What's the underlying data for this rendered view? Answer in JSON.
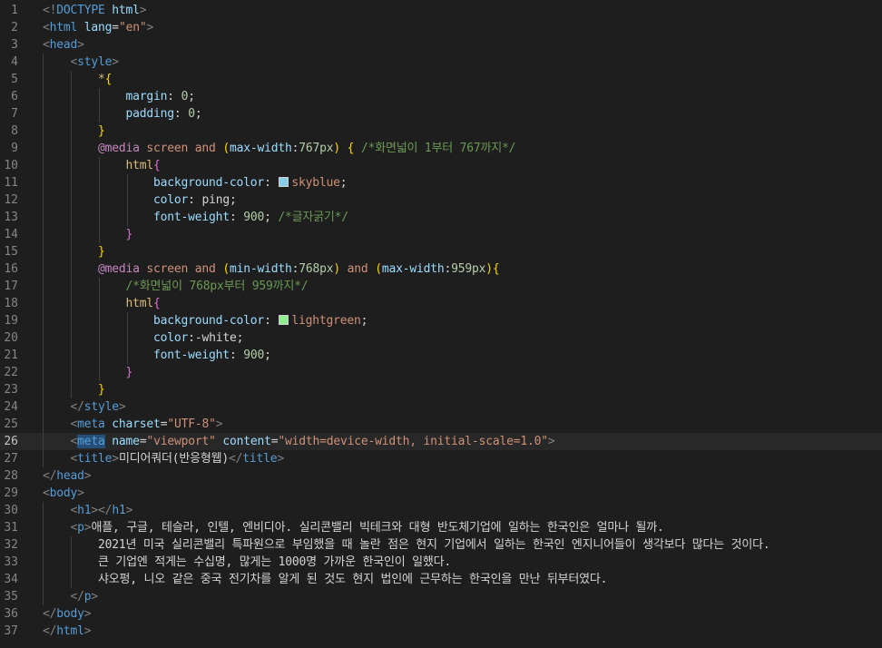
{
  "editor": {
    "active_line": 26,
    "lines": [
      {
        "n": "1",
        "tokens": [
          [
            "<!",
            "t-punc"
          ],
          [
            "DOCTYPE",
            "t-tag"
          ],
          [
            " html",
            "t-attr"
          ],
          [
            ">",
            "t-punc"
          ]
        ]
      },
      {
        "n": "2",
        "tokens": [
          [
            "<",
            "t-punc"
          ],
          [
            "html",
            "t-tag"
          ],
          [
            " lang",
            "t-attr"
          ],
          [
            "=",
            "t-txt"
          ],
          [
            "\"en\"",
            "t-str"
          ],
          [
            ">",
            "t-punc"
          ]
        ]
      },
      {
        "n": "3",
        "tokens": [
          [
            "<",
            "t-punc"
          ],
          [
            "head",
            "t-tag"
          ],
          [
            ">",
            "t-punc"
          ]
        ]
      },
      {
        "n": "4",
        "tokens": [
          [
            "    ",
            "t-txt"
          ],
          [
            "<",
            "t-punc"
          ],
          [
            "style",
            "t-tag"
          ],
          [
            ">",
            "t-punc"
          ]
        ]
      },
      {
        "n": "5",
        "tokens": [
          [
            "        ",
            "t-txt"
          ],
          [
            "*",
            "t-sel"
          ],
          [
            "{",
            "t-br"
          ]
        ]
      },
      {
        "n": "6",
        "tokens": [
          [
            "            ",
            "t-txt"
          ],
          [
            "margin",
            "t-prop"
          ],
          [
            ": ",
            "t-txt"
          ],
          [
            "0",
            "t-num"
          ],
          [
            ";",
            "t-txt"
          ]
        ]
      },
      {
        "n": "7",
        "tokens": [
          [
            "            ",
            "t-txt"
          ],
          [
            "padding",
            "t-prop"
          ],
          [
            ": ",
            "t-txt"
          ],
          [
            "0",
            "t-num"
          ],
          [
            ";",
            "t-txt"
          ]
        ]
      },
      {
        "n": "8",
        "tokens": [
          [
            "        ",
            "t-txt"
          ],
          [
            "}",
            "t-br"
          ]
        ]
      },
      {
        "n": "9",
        "tokens": [
          [
            "        ",
            "t-txt"
          ],
          [
            "@media",
            "t-at"
          ],
          [
            " screen ",
            "t-kw"
          ],
          [
            "and",
            "t-kw"
          ],
          [
            " ",
            "t-txt"
          ],
          [
            "(",
            "t-br"
          ],
          [
            "max-width",
            "t-prop"
          ],
          [
            ":",
            "t-txt"
          ],
          [
            "767px",
            "t-num"
          ],
          [
            ")",
            "t-br"
          ],
          [
            " ",
            "t-txt"
          ],
          [
            "{",
            "t-br"
          ],
          [
            " ",
            "t-txt"
          ],
          [
            "/*화면넓이 1부터 767까지*/",
            "t-com"
          ]
        ]
      },
      {
        "n": "10",
        "tokens": [
          [
            "            ",
            "t-txt"
          ],
          [
            "html",
            "t-sel"
          ],
          [
            "{",
            "t-br2"
          ]
        ]
      },
      {
        "n": "11",
        "tokens": [
          [
            "                ",
            "t-txt"
          ],
          [
            "background-color",
            "t-prop"
          ],
          [
            ": ",
            "t-txt"
          ],
          [
            "#skyblue",
            "swatch:#87ceeb"
          ],
          [
            "skyblue",
            "t-str"
          ],
          [
            ";",
            "t-txt"
          ]
        ]
      },
      {
        "n": "12",
        "tokens": [
          [
            "                ",
            "t-txt"
          ],
          [
            "color",
            "t-prop"
          ],
          [
            ": ",
            "t-txt"
          ],
          [
            "ping",
            "t-txt"
          ],
          [
            ";",
            "t-txt"
          ]
        ]
      },
      {
        "n": "13",
        "tokens": [
          [
            "                ",
            "t-txt"
          ],
          [
            "font-weight",
            "t-prop"
          ],
          [
            ": ",
            "t-txt"
          ],
          [
            "900",
            "t-num"
          ],
          [
            "; ",
            "t-txt"
          ],
          [
            "/*글자굵기*/",
            "t-com"
          ]
        ]
      },
      {
        "n": "14",
        "tokens": [
          [
            "            ",
            "t-txt"
          ],
          [
            "}",
            "t-br2"
          ]
        ]
      },
      {
        "n": "15",
        "tokens": [
          [
            "        ",
            "t-txt"
          ],
          [
            "}",
            "t-br"
          ]
        ]
      },
      {
        "n": "16",
        "tokens": [
          [
            "        ",
            "t-txt"
          ],
          [
            "@media",
            "t-at"
          ],
          [
            " screen ",
            "t-kw"
          ],
          [
            "and",
            "t-kw"
          ],
          [
            " ",
            "t-txt"
          ],
          [
            "(",
            "t-br"
          ],
          [
            "min-width",
            "t-prop"
          ],
          [
            ":",
            "t-txt"
          ],
          [
            "768px",
            "t-num"
          ],
          [
            ")",
            "t-br"
          ],
          [
            " ",
            "t-txt"
          ],
          [
            "and",
            "t-kw"
          ],
          [
            " ",
            "t-txt"
          ],
          [
            "(",
            "t-br"
          ],
          [
            "max-width",
            "t-prop"
          ],
          [
            ":",
            "t-txt"
          ],
          [
            "959px",
            "t-num"
          ],
          [
            ")",
            "t-br"
          ],
          [
            "{",
            "t-br"
          ]
        ]
      },
      {
        "n": "17",
        "tokens": [
          [
            "            ",
            "t-txt"
          ],
          [
            "/*화면넓이 768px부터 959까지*/",
            "t-com"
          ]
        ]
      },
      {
        "n": "18",
        "tokens": [
          [
            "            ",
            "t-txt"
          ],
          [
            "html",
            "t-sel"
          ],
          [
            "{",
            "t-br2"
          ]
        ]
      },
      {
        "n": "19",
        "tokens": [
          [
            "                ",
            "t-txt"
          ],
          [
            "background-color",
            "t-prop"
          ],
          [
            ": ",
            "t-txt"
          ],
          [
            "#lightgreen",
            "swatch:#90ee90"
          ],
          [
            "lightgreen",
            "t-str"
          ],
          [
            ";",
            "t-txt"
          ]
        ]
      },
      {
        "n": "20",
        "tokens": [
          [
            "                ",
            "t-txt"
          ],
          [
            "color",
            "t-prop"
          ],
          [
            ":",
            "t-txt"
          ],
          [
            "-white",
            "t-txt"
          ],
          [
            ";",
            "t-txt"
          ]
        ]
      },
      {
        "n": "21",
        "tokens": [
          [
            "                ",
            "t-txt"
          ],
          [
            "font-weight",
            "t-prop"
          ],
          [
            ": ",
            "t-txt"
          ],
          [
            "900",
            "t-num"
          ],
          [
            ";",
            "t-txt"
          ]
        ]
      },
      {
        "n": "22",
        "tokens": [
          [
            "            ",
            "t-txt"
          ],
          [
            "}",
            "t-br2"
          ]
        ]
      },
      {
        "n": "23",
        "tokens": [
          [
            "        ",
            "t-txt"
          ],
          [
            "}",
            "t-br"
          ]
        ]
      },
      {
        "n": "24",
        "tokens": [
          [
            "    ",
            "t-txt"
          ],
          [
            "</",
            "t-punc"
          ],
          [
            "style",
            "t-tag"
          ],
          [
            ">",
            "t-punc"
          ]
        ]
      },
      {
        "n": "25",
        "tokens": [
          [
            "    ",
            "t-txt"
          ],
          [
            "<",
            "t-punc"
          ],
          [
            "meta",
            "t-tag"
          ],
          [
            " charset",
            "t-attr"
          ],
          [
            "=",
            "t-txt"
          ],
          [
            "\"UTF-8\"",
            "t-str"
          ],
          [
            ">",
            "t-punc"
          ]
        ]
      },
      {
        "n": "26",
        "tokens": [
          [
            "    ",
            "t-txt"
          ],
          [
            "<",
            "t-punc"
          ],
          [
            "meta",
            "t-tag t-hl"
          ],
          [
            " name",
            "t-attr"
          ],
          [
            "=",
            "t-txt"
          ],
          [
            "\"viewport\"",
            "t-str"
          ],
          [
            " content",
            "t-attr"
          ],
          [
            "=",
            "t-txt"
          ],
          [
            "\"width=device-width, initial-scale=1.0\"",
            "t-str"
          ],
          [
            ">",
            "t-punc"
          ]
        ]
      },
      {
        "n": "27",
        "tokens": [
          [
            "    ",
            "t-txt"
          ],
          [
            "<",
            "t-punc"
          ],
          [
            "title",
            "t-tag"
          ],
          [
            ">",
            "t-punc"
          ],
          [
            "미디어쿼더(반응형웹)",
            "t-txt"
          ],
          [
            "</",
            "t-punc"
          ],
          [
            "title",
            "t-tag"
          ],
          [
            ">",
            "t-punc"
          ]
        ]
      },
      {
        "n": "28",
        "tokens": [
          [
            "</",
            "t-punc"
          ],
          [
            "head",
            "t-tag"
          ],
          [
            ">",
            "t-punc"
          ]
        ]
      },
      {
        "n": "29",
        "tokens": [
          [
            "<",
            "t-punc"
          ],
          [
            "body",
            "t-tag"
          ],
          [
            ">",
            "t-punc"
          ]
        ]
      },
      {
        "n": "30",
        "tokens": [
          [
            "    ",
            "t-txt"
          ],
          [
            "<",
            "t-punc"
          ],
          [
            "h1",
            "t-tag"
          ],
          [
            "></",
            "t-punc"
          ],
          [
            "h1",
            "t-tag"
          ],
          [
            ">",
            "t-punc"
          ]
        ]
      },
      {
        "n": "31",
        "tokens": [
          [
            "    ",
            "t-txt"
          ],
          [
            "<",
            "t-punc"
          ],
          [
            "p",
            "t-tag"
          ],
          [
            ">",
            "t-punc"
          ],
          [
            "애플, 구글, 테슬라, 인텔, 엔비디아. 실리콘밸리 빅테크와 대형 반도체기업에 일하는 한국인은 얼마나 될까.",
            "t-txt"
          ]
        ]
      },
      {
        "n": "32",
        "tokens": [
          [
            "        ",
            "t-txt"
          ],
          [
            "2021년 미국 실리콘밸리 특파원으로 부임했을 때 놀란 점은 현지 기업에서 일하는 한국인 엔지니어들이 생각보다 많다는 것이다.",
            "t-txt"
          ]
        ]
      },
      {
        "n": "33",
        "tokens": [
          [
            "        ",
            "t-txt"
          ],
          [
            "큰 기업엔 적게는 수십명, 많게는 1000명 가까운 한국인이 일했다.",
            "t-txt"
          ]
        ]
      },
      {
        "n": "34",
        "tokens": [
          [
            "        ",
            "t-txt"
          ],
          [
            "샤오펑, 니오 같은 중국 전기차를 알게 된 것도 현지 법인에 근무하는 한국인을 만난 뒤부터였다.",
            "t-txt"
          ]
        ]
      },
      {
        "n": "35",
        "tokens": [
          [
            "    ",
            "t-txt"
          ],
          [
            "</",
            "t-punc"
          ],
          [
            "p",
            "t-tag"
          ],
          [
            ">",
            "t-punc"
          ]
        ]
      },
      {
        "n": "36",
        "tokens": [
          [
            "</",
            "t-punc"
          ],
          [
            "body",
            "t-tag"
          ],
          [
            ">",
            "t-punc"
          ]
        ]
      },
      {
        "n": "37",
        "tokens": [
          [
            "</",
            "t-punc"
          ],
          [
            "html",
            "t-tag"
          ],
          [
            ">",
            "t-punc"
          ]
        ]
      }
    ]
  }
}
